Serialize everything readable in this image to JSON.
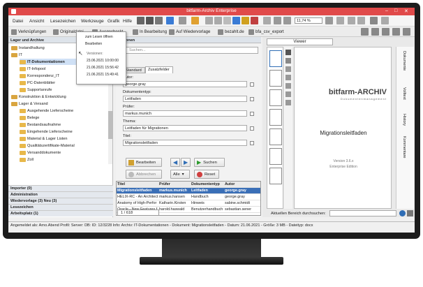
{
  "window": {
    "title": "bitfarm-Archiv  Enterprise"
  },
  "menu": [
    "Datei",
    "Ansicht",
    "Lesezeichen",
    "Werkzeuge",
    "Grafik",
    "Hilfe"
  ],
  "toolbar": {
    "zoom": "11,74 %"
  },
  "quick_tabs": [
    "Verknüpfungen",
    "Originaldatei",
    "Ausgecheckt",
    "In Bearbeitung",
    "Auf Wiedervorlage",
    "bezahlt.de",
    "bfa_csv_export"
  ],
  "left": {
    "header": "Lager und Archive",
    "tree": [
      "Instandhaltung",
      "IT",
      "IT-Dokumentationen",
      "IT-Infopool",
      "Korrespondenz_IT",
      "PC-Datenblätter",
      "Supportanrufe",
      "Konstruktion & Entwicklung",
      "Lager & Versand",
      "Ausgehende Lieferscheine",
      "Belege",
      "Bestandsaufnahme",
      "Eingehende Lieferscheine",
      "Material & Lager Listen",
      "Qualitätszertifikate-Material",
      "Versanddokumente",
      "Zoll"
    ],
    "sections": [
      "Importer (0)",
      "Administration",
      "Wiedervorlage (3)  Neu (3)",
      "Lesezeichen",
      "Arbeitsplatz (1)"
    ]
  },
  "popup": {
    "item1": "zum Lesen öffnen",
    "item2": "Bearbeiten",
    "versions_label": "Versionen:",
    "versions": [
      "23.06.2021  10:00:00",
      "21.06.2021  15:56:42",
      "21.06.2021  15:49:41"
    ]
  },
  "mid": {
    "header": "Optionen",
    "search_placeholder": "Suchen...",
    "tab1": "Standard",
    "tab2": "Zusatzfelder",
    "fields": [
      {
        "label": "Autor:",
        "value": "george.gray"
      },
      {
        "label": "Dokumententyp:",
        "value": "Leitfaden"
      },
      {
        "label": "Prüfer:",
        "value": "markus.munich"
      },
      {
        "label": "Thema:",
        "value": "Leitfaden für Migrationen"
      },
      {
        "label": "Titel:",
        "value": "Migrationsleitfaden"
      }
    ],
    "btn_edit": "Bearbeiten",
    "btn_search": "Suchen",
    "btn_cancel": "Abbrechen",
    "btn_all": "Alle",
    "btn_reset": "Reset"
  },
  "grid": {
    "headers": [
      "Titel",
      "Prüfer",
      "Dokumententyp",
      "Autor"
    ],
    "rows": [
      [
        "Migrationsleitfaden",
        "markus.munich",
        "Leitfaden",
        "george.gray"
      ],
      [
        "HELIX-RC - An Architect",
        "markus.hansen",
        "Handbuch",
        "george.gray"
      ],
      [
        "Anatomy of High-Perfor",
        "Katharin.Kirsten",
        "Hinweis",
        "sabine.schmidt"
      ],
      [
        "Oracle - New Features f",
        "harold.haswald",
        "Benutzerhandbuch",
        "sebastian.sener"
      ]
    ],
    "footer": "1 / 618"
  },
  "viewer": {
    "tab": "Viewer",
    "logo": "bitfarm-ARCHIV",
    "logo_sub": "Dokumentenmanagement",
    "doc_title": "Migrationsleitfaden",
    "version": "Version 3.6.x",
    "edition": "Enterprise Edition",
    "find_label": "Aktuellen Bereich durchsuchen:",
    "side_tabs": [
      "Dokumente",
      "Volltext",
      "History",
      "Kommentare"
    ]
  },
  "status": "Angemeldet als:  Arno.Abend   Profil:            Server:             DB:                     ID:  12/3228    Info:  Archiv: IT-Dokumentationen - Dokument: Migrationsleitfaden - Datum: 21.06.2021 - Größe: 3 MB - Dateityp: docx",
  "colors": {
    "title_bar": "#e04a4a",
    "accent": "#2f6db5"
  }
}
